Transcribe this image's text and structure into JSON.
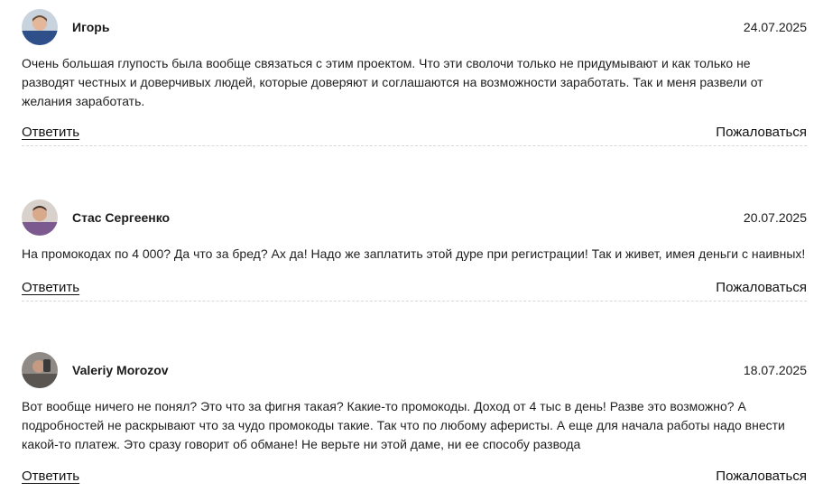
{
  "comments": [
    {
      "author": "Игорь",
      "date": "24.07.2025",
      "text": "Очень большая глупость была вообще связаться с этим проектом. Что эти сволочи только не придумывают и как только не разводят честных и доверчивых людей, которые доверяют и соглашаются на возможности заработать. Так и меня развели от желания заработать.",
      "reply_label": "Ответить",
      "report_label": "Пожаловаться"
    },
    {
      "author": "Стас Сергеенко",
      "date": "20.07.2025",
      "text": "На промокодах по 4 000? Да что за бред? Ах да! Надо же заплатить этой дуре при регистрации! Так и живет, имея деньги с наивных!",
      "reply_label": "Ответить",
      "report_label": "Пожаловаться"
    },
    {
      "author": "Valeriy Morozov",
      "date": "18.07.2025",
      "text": "Вот вообще ничего не понял? Это что за фигня такая? Какие-то промокоды. Доход от 4 тыс в день! Разве это возможно? А подробностей не раскрывают что за чудо промокоды такие. Так что по любому аферисты. А еще для начала работы надо внести какой-то платеж. Это сразу говорит об обмане! Не верьте ни этой даме, ни ее способу развода",
      "reply_label": "Ответить",
      "report_label": "Пожаловаться"
    }
  ],
  "colors": {
    "text": "#1f1f1f",
    "divider": "#d8d8d8"
  },
  "icons": [
    "avatar-photo-igor",
    "avatar-photo-stas",
    "avatar-photo-valeriy"
  ]
}
